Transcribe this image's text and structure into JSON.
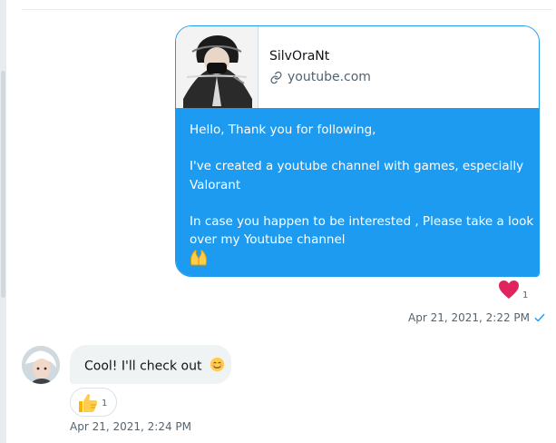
{
  "outgoing": {
    "link_preview": {
      "title": "SilvOraNt",
      "domain": "youtube.com"
    },
    "message_lines": [
      "Hello, Thank you for following,",
      "I've created a youtube channel with games,  especially",
      "Valorant",
      "In case you happen to be interested , Please take a look",
      "over  my Youtube channel"
    ],
    "reaction": {
      "icon": "heart-icon",
      "count": "1",
      "color": "#e0245e"
    },
    "timestamp": "Apr 21, 2021, 2:22 PM",
    "status_icon": "check-icon"
  },
  "incoming": {
    "message": "Cool! I'll check out",
    "emoji": "smiling-face-icon",
    "reaction": {
      "icon": "thumbs-up-icon",
      "count": "1"
    },
    "timestamp": "Apr 21, 2021, 2:24 PM"
  },
  "colors": {
    "accent": "#1d9bf0",
    "incoming_bubble": "#eff3f4",
    "muted_text": "#536471"
  }
}
